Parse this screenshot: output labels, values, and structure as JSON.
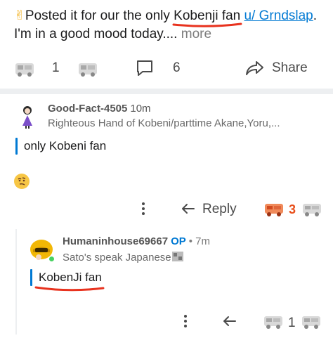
{
  "post": {
    "emoji": "✌",
    "text_before": "Posted it for our the only ",
    "highlight": "Kobenji",
    "text_mid": " fan ",
    "link": "u/ Grndslap",
    "text_after": ". I'm in a good mood today.... ",
    "more": "more"
  },
  "actions": {
    "upvotes": "1",
    "comments": "6",
    "share_label": "Share"
  },
  "comment1": {
    "username": "Good-Fact-4505",
    "time": "10m",
    "flair": "Righteous Hand of Kobeni/parttime Akane,Yoru,...",
    "body": "only Kobeni fan",
    "reply_label": "Reply",
    "award_count": "3"
  },
  "comment2": {
    "username": "Humaninhouse69667",
    "op_badge": "OP",
    "time": "• 7m",
    "flair": "Sato's speak Japanese",
    "body": "KobenJi fan",
    "upvotes": "1"
  },
  "colors": {
    "accent": "#0079d3",
    "highlight_underline": "#e8321e",
    "online": "#46d160",
    "award": "#e8501c"
  }
}
